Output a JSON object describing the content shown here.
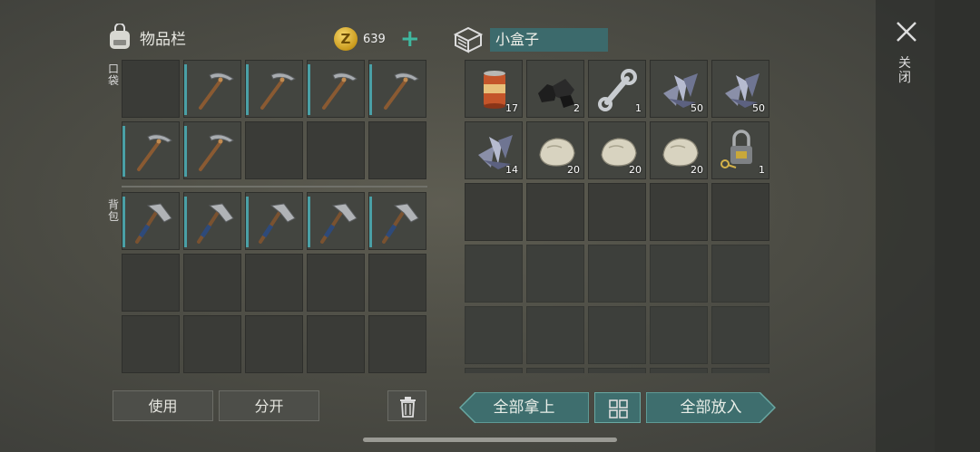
{
  "inventory": {
    "title": "物品栏",
    "coins": "639",
    "coin_symbol": "Z",
    "pocket_label": "口袋",
    "backpack_label": "背包",
    "pocket_slots": [
      {
        "item": "",
        "count": ""
      },
      {
        "item": "pickaxe",
        "count": ""
      },
      {
        "item": "pickaxe",
        "count": ""
      },
      {
        "item": "pickaxe",
        "count": ""
      },
      {
        "item": "pickaxe",
        "count": ""
      },
      {
        "item": "pickaxe",
        "count": ""
      },
      {
        "item": "pickaxe",
        "count": ""
      },
      {
        "item": "",
        "count": ""
      },
      {
        "item": "",
        "count": ""
      },
      {
        "item": "",
        "count": ""
      }
    ],
    "backpack_slots": [
      {
        "item": "axe",
        "count": ""
      },
      {
        "item": "axe",
        "count": ""
      },
      {
        "item": "axe",
        "count": ""
      },
      {
        "item": "axe",
        "count": ""
      },
      {
        "item": "axe",
        "count": ""
      },
      {
        "item": "",
        "count": ""
      },
      {
        "item": "",
        "count": ""
      },
      {
        "item": "",
        "count": ""
      },
      {
        "item": "",
        "count": ""
      },
      {
        "item": "",
        "count": ""
      },
      {
        "item": "",
        "count": ""
      },
      {
        "item": "",
        "count": ""
      },
      {
        "item": "",
        "count": ""
      },
      {
        "item": "",
        "count": ""
      },
      {
        "item": "",
        "count": ""
      }
    ],
    "use_label": "使用",
    "split_label": "分开"
  },
  "box": {
    "name": "小盒子",
    "slots": [
      {
        "item": "can",
        "count": "17"
      },
      {
        "item": "coal",
        "count": "2"
      },
      {
        "item": "wrench",
        "count": "1"
      },
      {
        "item": "scrap",
        "count": "50"
      },
      {
        "item": "scrap",
        "count": "50"
      },
      {
        "item": "scrap",
        "count": "14"
      },
      {
        "item": "stone",
        "count": "20"
      },
      {
        "item": "stone",
        "count": "20"
      },
      {
        "item": "stone",
        "count": "20"
      },
      {
        "item": "lock",
        "count": "1"
      },
      {
        "item": "",
        "count": ""
      },
      {
        "item": "",
        "count": ""
      },
      {
        "item": "",
        "count": ""
      },
      {
        "item": "",
        "count": ""
      },
      {
        "item": "",
        "count": ""
      },
      {
        "item": "",
        "count": ""
      },
      {
        "item": "",
        "count": ""
      },
      {
        "item": "",
        "count": ""
      },
      {
        "item": "",
        "count": ""
      },
      {
        "item": "",
        "count": ""
      },
      {
        "item": "",
        "count": ""
      },
      {
        "item": "",
        "count": ""
      },
      {
        "item": "",
        "count": ""
      },
      {
        "item": "",
        "count": ""
      },
      {
        "item": "",
        "count": ""
      },
      {
        "item": "",
        "count": ""
      },
      {
        "item": "",
        "count": ""
      },
      {
        "item": "",
        "count": ""
      },
      {
        "item": "",
        "count": ""
      },
      {
        "item": "",
        "count": ""
      }
    ],
    "take_all_label": "全部拿上",
    "put_all_label": "全部放入"
  },
  "close_label": "关闭",
  "colors": {
    "accent": "#3fb8a0",
    "teal_button": "#3e6e6e",
    "durability": "#4aa0a6"
  }
}
